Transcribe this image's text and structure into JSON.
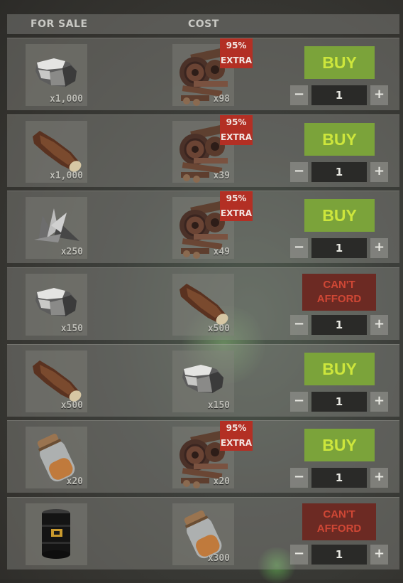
{
  "header": {
    "for_sale": "FOR SALE",
    "cost": "COST"
  },
  "labels": {
    "buy": "BUY",
    "cant_1": "CAN'T",
    "cant_2": "AFFORD",
    "extra_pct": "95%",
    "extra_word": "EXTRA",
    "minus": "−",
    "plus": "+"
  },
  "colors": {
    "buy_bg": "#7ba33a",
    "buy_text": "#cde63c",
    "cant_bg": "#6c2a23",
    "cant_text": "#cf4735",
    "extra_bg": "#b32f24"
  },
  "rows": [
    {
      "sale_icon": "stone-icon",
      "sale_qty": "x1,000",
      "cost_icon": "scrap-icon",
      "cost_qty": "x98",
      "bonus": true,
      "status": "buy",
      "quantity": "1"
    },
    {
      "sale_icon": "wood-icon",
      "sale_qty": "x1,000",
      "cost_icon": "scrap-icon",
      "cost_qty": "x39",
      "bonus": true,
      "status": "buy",
      "quantity": "1"
    },
    {
      "sale_icon": "metal-fragments-icon",
      "sale_qty": "x250",
      "cost_icon": "scrap-icon",
      "cost_qty": "x49",
      "bonus": true,
      "status": "buy",
      "quantity": "1"
    },
    {
      "sale_icon": "stone-icon",
      "sale_qty": "x150",
      "cost_icon": "wood-icon",
      "cost_qty": "x500",
      "bonus": false,
      "status": "cant_afford",
      "quantity": "1"
    },
    {
      "sale_icon": "wood-icon",
      "sale_qty": "x500",
      "cost_icon": "stone-icon",
      "cost_qty": "x150",
      "bonus": false,
      "status": "buy",
      "quantity": "1"
    },
    {
      "sale_icon": "sulfur-jar-icon",
      "sale_qty": "x20",
      "cost_icon": "scrap-icon",
      "cost_qty": "x20",
      "bonus": true,
      "status": "buy",
      "quantity": "1"
    },
    {
      "sale_icon": "oil-barrel-icon",
      "sale_qty": "",
      "cost_icon": "sulfur-jar-icon",
      "cost_qty": "x300",
      "bonus": false,
      "status": "cant_afford",
      "quantity": "1"
    }
  ]
}
